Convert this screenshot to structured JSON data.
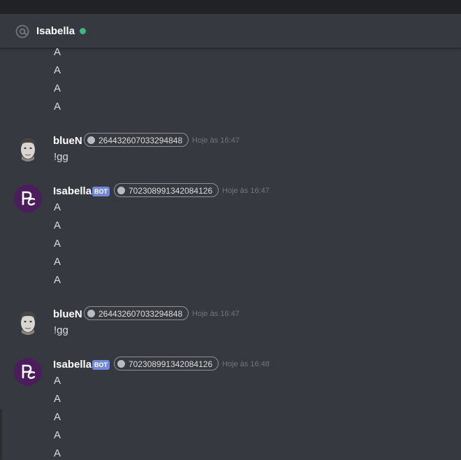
{
  "header": {
    "title": "Isabella",
    "status_color": "#43b581"
  },
  "messages": [
    {
      "type": "continuation",
      "lines": [
        "A",
        "A",
        "A",
        "A"
      ]
    },
    {
      "type": "group",
      "author": "blueN",
      "author_id": "264432607033294848",
      "timestamp": "Hoje às 16:47",
      "is_bot": false,
      "lines": [
        "!gg"
      ]
    },
    {
      "type": "group",
      "author": "Isabella",
      "bot_tag": "BOT",
      "author_id": "702308991342084126",
      "timestamp": "Hoje às 16:47",
      "is_bot": true,
      "lines": [
        "A",
        "A",
        "A",
        "A",
        "A"
      ]
    },
    {
      "type": "group",
      "author": "blueN",
      "author_id": "264432607033294848",
      "timestamp": "Hoje às 16:47",
      "is_bot": false,
      "lines": [
        "!gg"
      ]
    },
    {
      "type": "group",
      "author": "Isabella",
      "bot_tag": "BOT",
      "author_id": "702308991342084126",
      "timestamp": "Hoje às 16:48",
      "is_bot": true,
      "lines": [
        "A",
        "A",
        "A",
        "A",
        "A"
      ]
    }
  ],
  "icons": {
    "header": "at-sign-icon",
    "user_avatar": "user-avatar-face-icon",
    "bot_avatar": "isabella-bot-logo-icon"
  },
  "colors": {
    "background": "#36393f",
    "bot_tag": "#7289da",
    "bot_avatar_bg": "#4c1d5c"
  }
}
